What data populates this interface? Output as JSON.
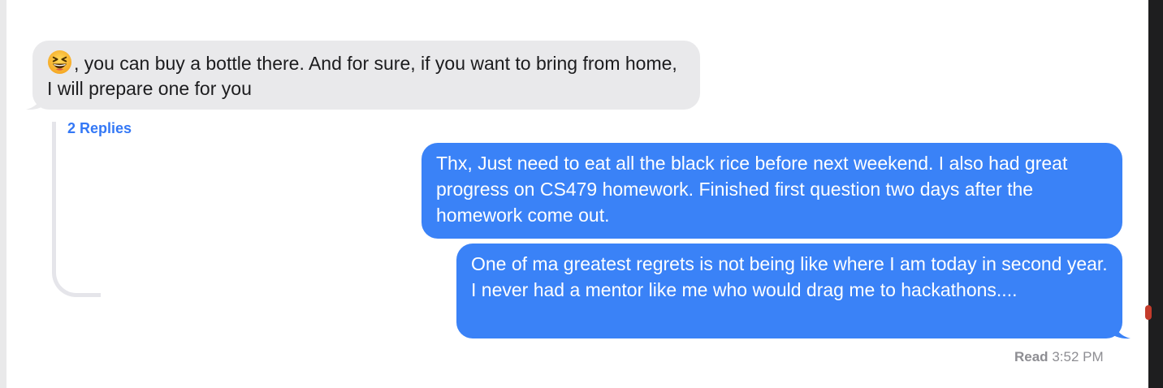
{
  "conversation": {
    "incoming": {
      "emoji": "grinning-squinting-face",
      "text": ", you can buy a bottle there. And for sure, if you want to bring from home, I will prepare one for you"
    },
    "thread": {
      "replies_label": "2 Replies"
    },
    "outgoing": [
      {
        "text": "Thx, Just need to eat all the black rice before next weekend. I also had great progress on CS479 homework. Finished first question two days after the homework come out."
      },
      {
        "text": "One of ma greatest regrets is not being like where I am today in second year. I never had a mentor like me who would drag me to hackathons...."
      }
    ],
    "receipt": {
      "label": "Read",
      "time": "3:52 PM"
    }
  },
  "colors": {
    "incoming_bubble": "#e9e9eb",
    "outgoing_bubble": "#3a82f7",
    "link": "#3478f6",
    "receipt_text": "#8e8e93"
  }
}
